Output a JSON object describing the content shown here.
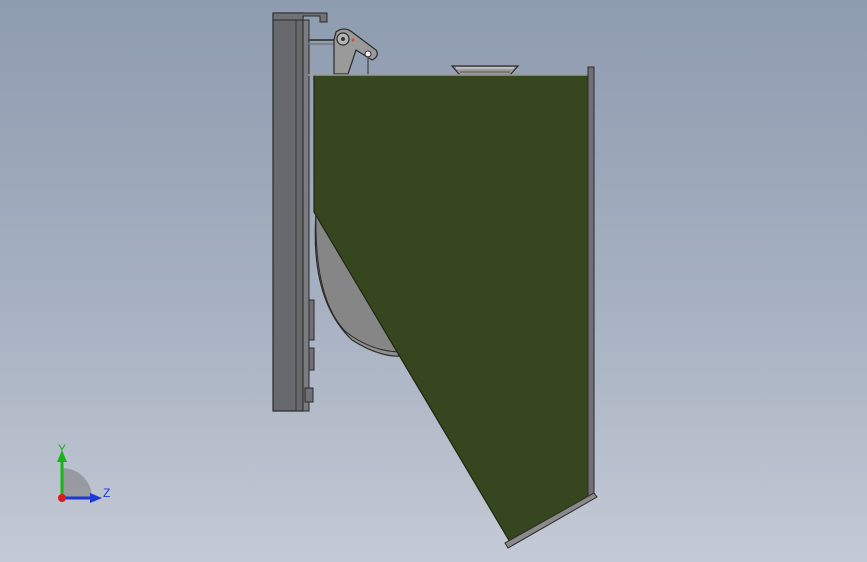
{
  "viewport": {
    "background_top": "#8e9cb0",
    "background_bottom": "#c4cad5"
  },
  "model": {
    "body_color": "#36461e",
    "frame_color": "#67696e",
    "part_color": "#8a8a8a",
    "edge_color": "#2a2a2a"
  },
  "triad": {
    "y_label": "Y",
    "z_label": "Z",
    "y_color": "#19b419",
    "z_color": "#1c39d6",
    "x_color": "#d61c1c"
  }
}
